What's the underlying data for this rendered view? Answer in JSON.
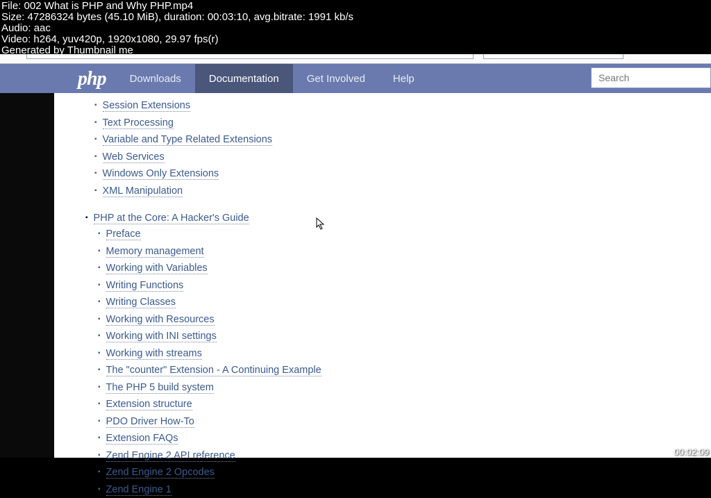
{
  "meta": {
    "file": "File: 002 What is PHP and Why PHP.mp4",
    "size": "Size: 47286324 bytes (45.10 MiB), duration: 00:03:10, avg.bitrate: 1991 kb/s",
    "audio": "Audio: aac",
    "video": "Video: h264, yuv420p, 1920x1080, 29.97 fps(r)",
    "gen": "Generated by Thumbnail me"
  },
  "nav": {
    "logo": "php",
    "items": [
      "Downloads",
      "Documentation",
      "Get Involved",
      "Help"
    ],
    "active": 1,
    "search_ph": "Search"
  },
  "group1": [
    "Session Extensions",
    "Text Processing",
    "Variable and Type Related Extensions",
    "Web Services",
    "Windows Only Extensions",
    "XML Manipulation"
  ],
  "section": "PHP at the Core: A Hacker's Guide",
  "group2": [
    "Preface",
    "Memory management",
    "Working with Variables",
    "Writing Functions",
    "Writing Classes",
    "Working with Resources",
    "Working with INI settings",
    "Working with streams",
    "The \"counter\" Extension - A Continuing Example",
    "The PHP 5 build system",
    "Extension structure",
    "PDO Driver How-To",
    "Extension FAQs",
    "Zend Engine 2 API reference",
    "Zend Engine 2 Opcodes",
    "Zend Engine 1"
  ],
  "timestamp": "00:02:09"
}
